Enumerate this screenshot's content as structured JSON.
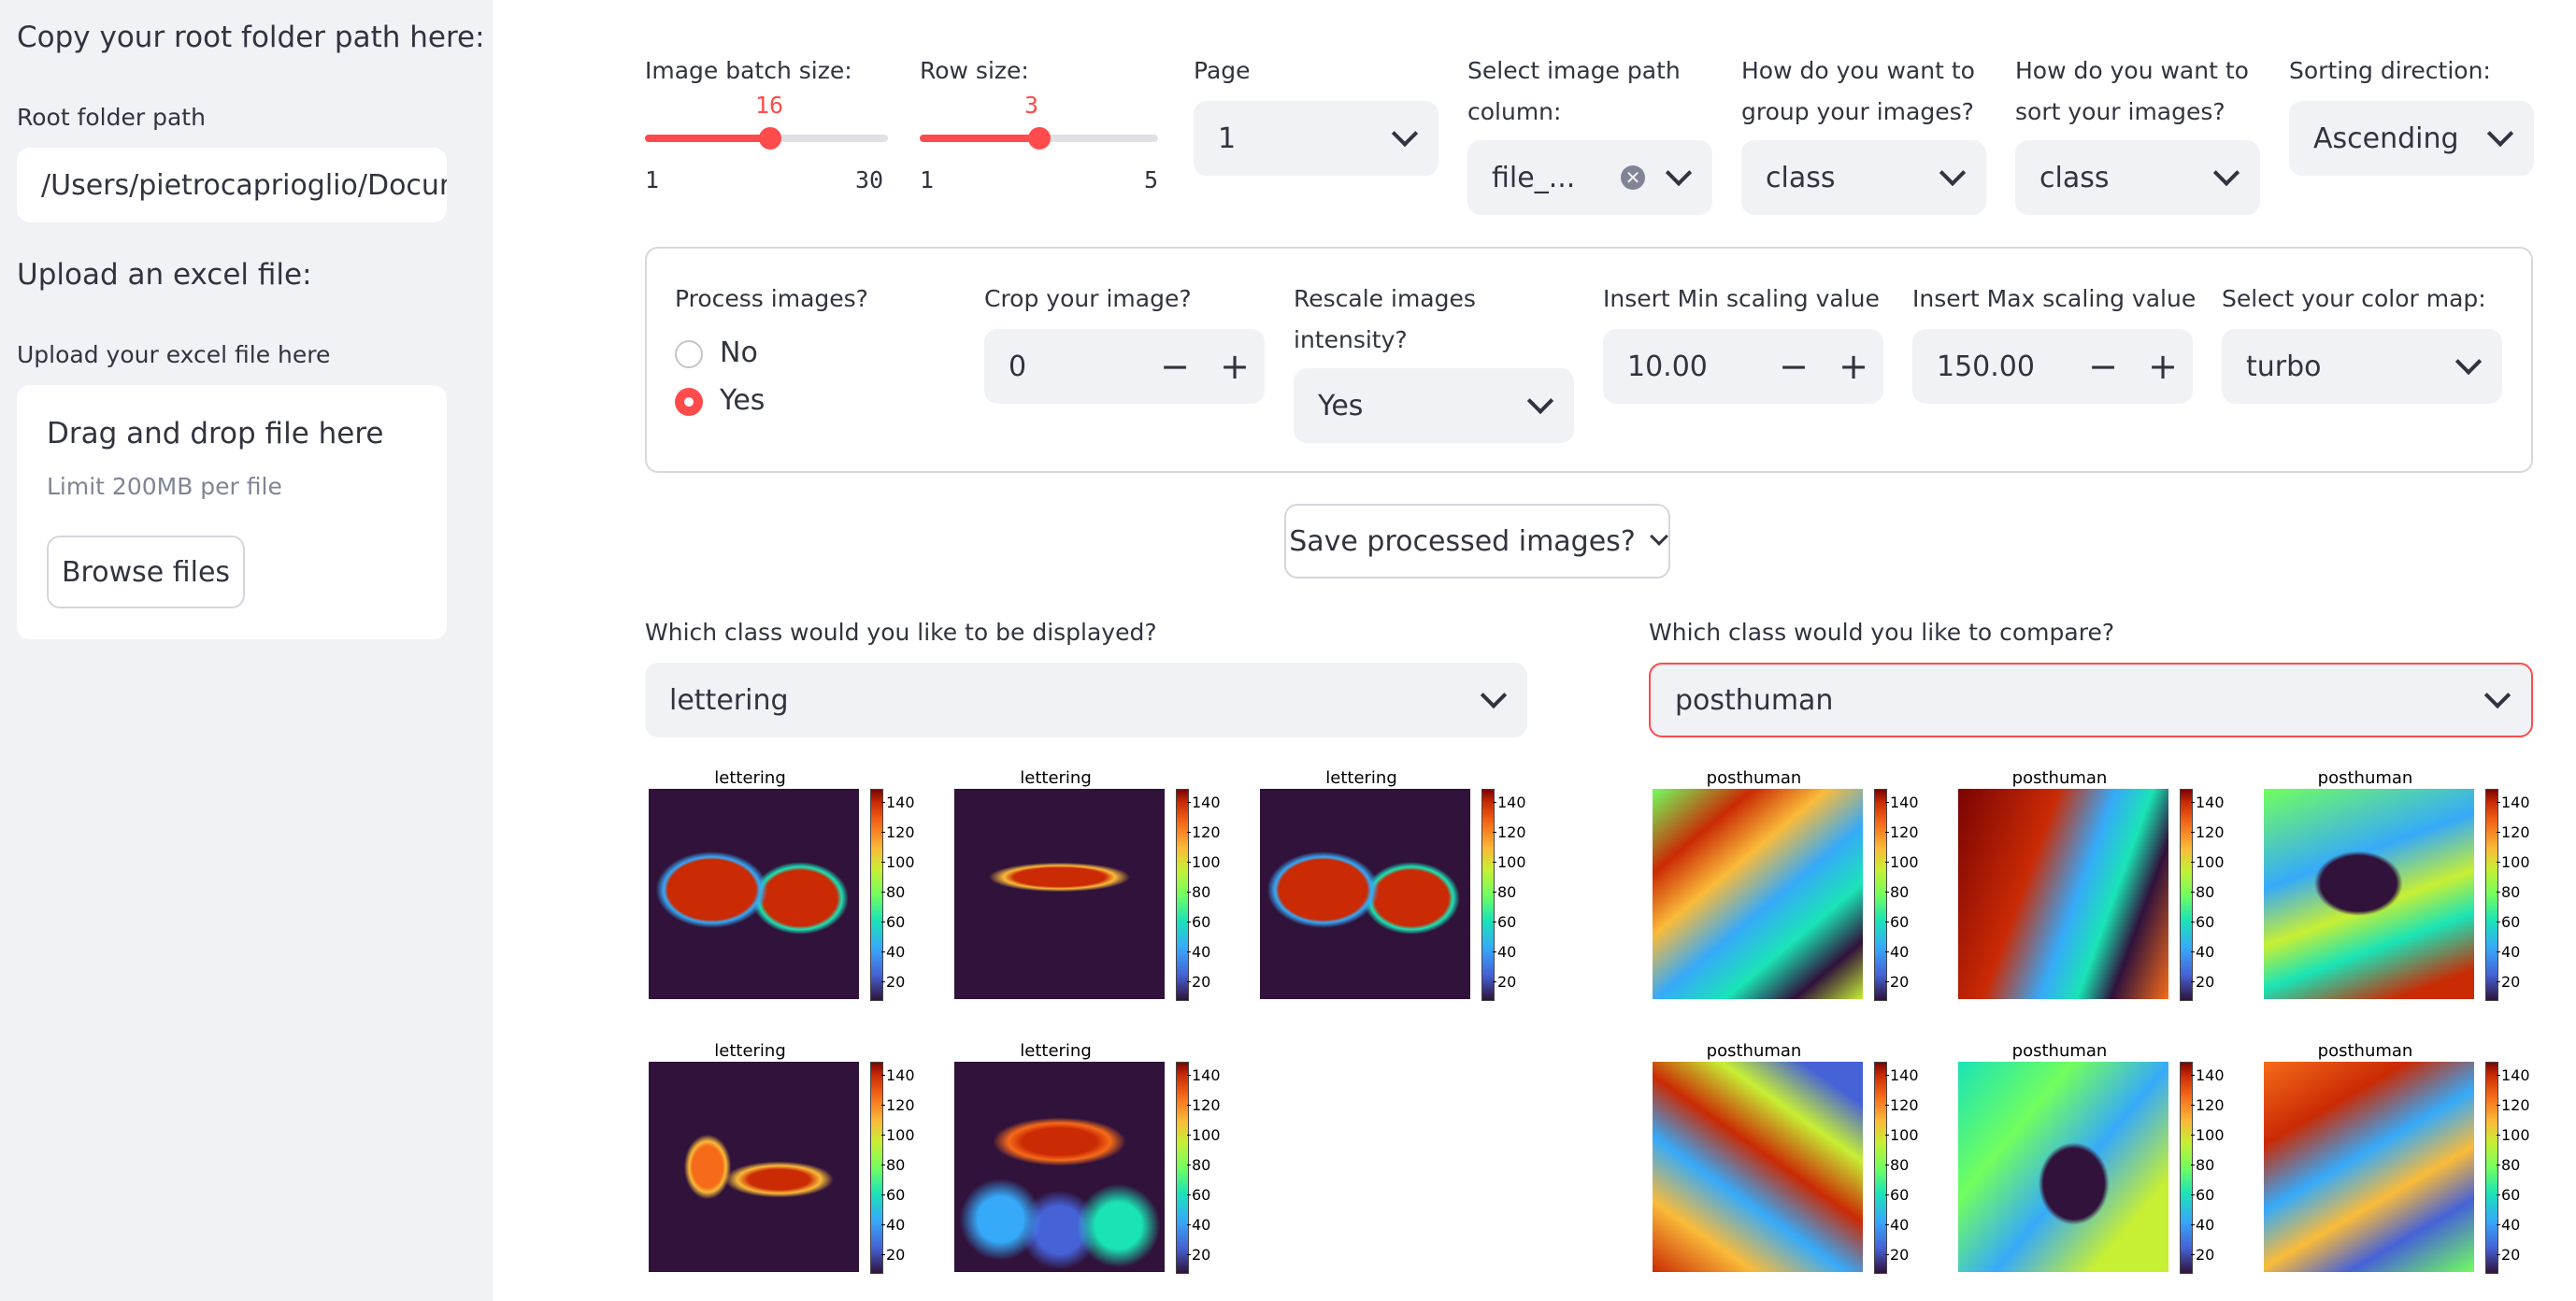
{
  "sidebar": {
    "root_header": "Copy your root folder path here:",
    "root_label": "Root folder path",
    "root_value": "/Users/pietrocaprioglio/Documents",
    "upload_header": "Upload an excel file:",
    "upload_label": "Upload your excel file here",
    "dropzone_title": "Drag and drop file here",
    "dropzone_limit": "Limit 200MB per file",
    "browse_button": "Browse files"
  },
  "controls": {
    "batch_size": {
      "label": "Image batch size:",
      "value": "16",
      "min": "1",
      "max": "30",
      "fraction": 0.517
    },
    "row_size": {
      "label": "Row size:",
      "value": "3",
      "min": "1",
      "max": "5",
      "fraction": 0.5
    },
    "page": {
      "label": "Page",
      "value": "1"
    },
    "path_column": {
      "label": "Select image path column:",
      "value": "file_..."
    },
    "group_by": {
      "label": "How do you want to group your images?",
      "value": "class"
    },
    "sort_by": {
      "label": "How do you want to sort your images?",
      "value": "class"
    },
    "sort_dir": {
      "label": "Sorting direction:",
      "value": "Ascending"
    }
  },
  "processing": {
    "process_label": "Process images?",
    "options": [
      "No",
      "Yes"
    ],
    "selected": "Yes",
    "crop": {
      "label": "Crop your image?",
      "value": "0"
    },
    "rescale": {
      "label": "Rescale images intensity?",
      "value": "Yes"
    },
    "min_scale": {
      "label": "Insert Min scaling value",
      "value": "10.00"
    },
    "max_scale": {
      "label": "Insert Max scaling value",
      "value": "150.00"
    },
    "colormap": {
      "label": "Select your color map:",
      "value": "turbo"
    },
    "minus": "−",
    "plus": "+"
  },
  "save_button": "Save processed images?",
  "left_panel": {
    "label": "Which class would you like to be displayed?",
    "value": "lettering",
    "plot_title": "lettering",
    "count": 5
  },
  "right_panel": {
    "label": "Which class would you like to compare?",
    "value": "posthuman",
    "plot_title": "posthuman",
    "count": 6
  },
  "colorbar_ticks": [
    "140",
    "120",
    "100",
    "80",
    "60",
    "40",
    "20"
  ],
  "colors": {
    "accent": "#ff4b4b",
    "sidebar_bg": "#f0f2f6",
    "input_bg": "#f0f2f6",
    "text": "#31333f",
    "plot_bg": "#30123b"
  }
}
